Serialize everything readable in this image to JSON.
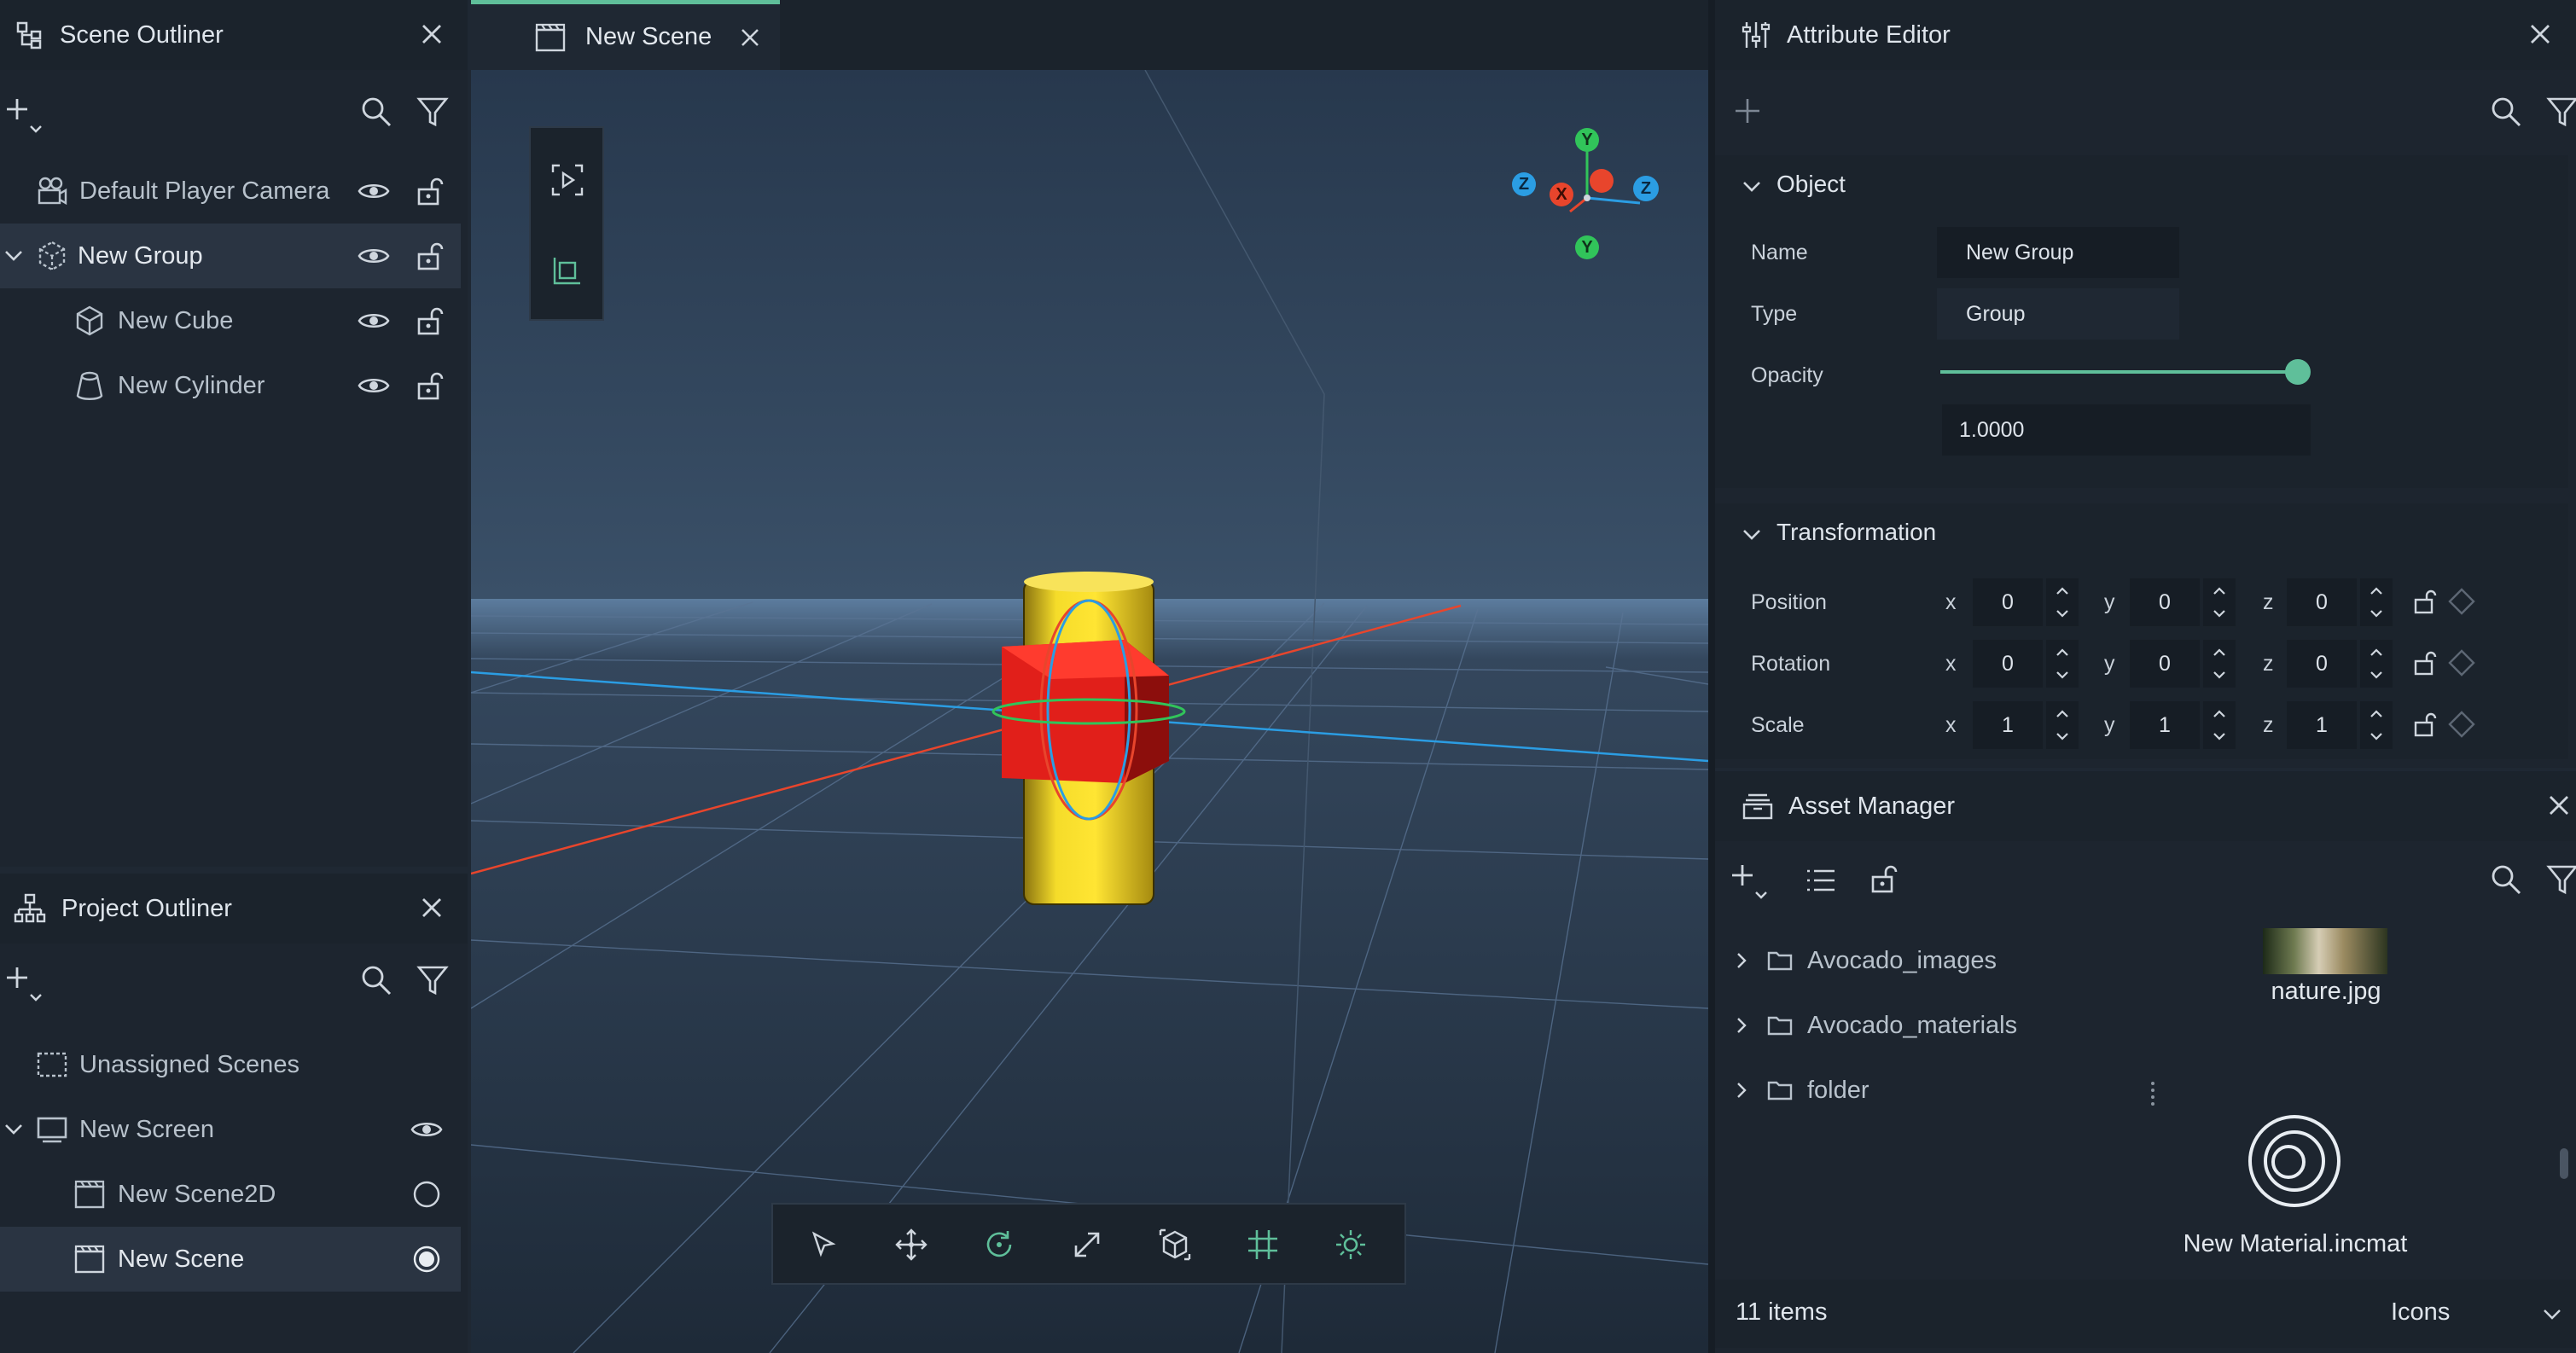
{
  "scene_outliner": {
    "title": "Scene Outliner",
    "items": [
      {
        "label": "Default Player Camera"
      },
      {
        "label": "New Group"
      },
      {
        "label": "New Cube"
      },
      {
        "label": "New Cylinder"
      }
    ]
  },
  "project_outliner": {
    "title": "Project Outliner",
    "items": [
      {
        "label": "Unassigned Scenes"
      },
      {
        "label": "New Screen"
      },
      {
        "label": "New Scene2D"
      },
      {
        "label": "New Scene"
      }
    ]
  },
  "viewport": {
    "tab_label": "New Scene",
    "gizmo": {
      "y": "Y",
      "x": "X",
      "z": "Z",
      "neg_y": "Y",
      "neg_z": "Z"
    }
  },
  "attribute_editor": {
    "title": "Attribute Editor",
    "object_section": "Object",
    "name_label": "Name",
    "name_value": "New Group",
    "type_label": "Type",
    "type_value": "Group",
    "opacity_label": "Opacity",
    "opacity_value": "1.0000",
    "opacity_fraction": 1.0,
    "transformation_section": "Transformation",
    "axis_x": "x",
    "axis_y": "y",
    "axis_z": "z",
    "position": {
      "label": "Position",
      "x": "0",
      "y": "0",
      "z": "0"
    },
    "rotation": {
      "label": "Rotation",
      "x": "0",
      "y": "0",
      "z": "0"
    },
    "scale": {
      "label": "Scale",
      "x": "1",
      "y": "1",
      "z": "1"
    }
  },
  "asset_manager": {
    "title": "Asset Manager",
    "folders": [
      {
        "label": "Avocado_images"
      },
      {
        "label": "Avocado_materials"
      },
      {
        "label": "folder"
      }
    ],
    "assets": [
      {
        "label": "nature.jpg"
      },
      {
        "label": "New Material.incmat"
      }
    ],
    "item_count": "11 items",
    "view_mode": "Icons"
  },
  "colors": {
    "accent": "#5fbf9a",
    "panel_bg": "#1d252f",
    "selection": "#2a3442",
    "axis_x": "#e8452c",
    "axis_y": "#31c45a",
    "axis_z": "#2b9de3"
  }
}
